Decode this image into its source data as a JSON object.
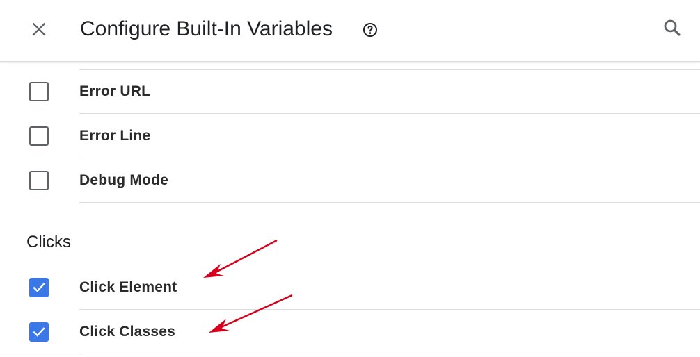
{
  "header": {
    "title": "Configure Built-In Variables",
    "close_icon": "close-icon",
    "help_icon": "help-circle-icon",
    "search_icon": "search-icon"
  },
  "variables": [
    {
      "label": "Error URL",
      "checked": false
    },
    {
      "label": "Error Line",
      "checked": false
    },
    {
      "label": "Debug Mode",
      "checked": false
    }
  ],
  "clicks_section": {
    "title": "Clicks",
    "items": [
      {
        "label": "Click Element",
        "checked": true
      },
      {
        "label": "Click Classes",
        "checked": true
      }
    ]
  },
  "colors": {
    "checkbox_checked": "#3b78e7",
    "annotation_arrow": "#d6001c"
  }
}
